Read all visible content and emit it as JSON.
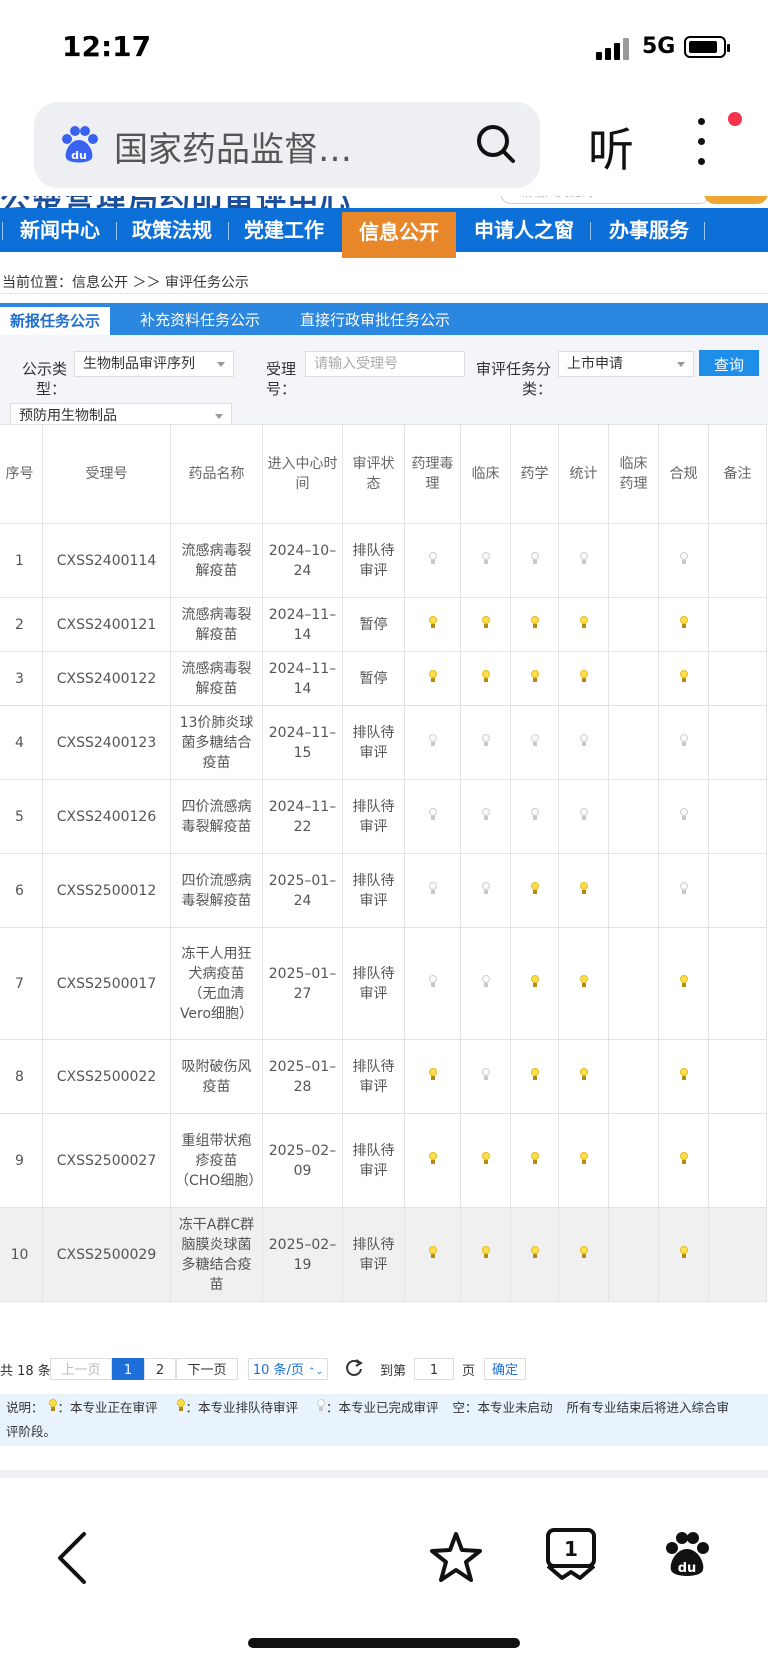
{
  "status_bar": {
    "time": "12:17",
    "network": "5G"
  },
  "browser": {
    "search_text": "国家药品监督…",
    "listen_label": "听"
  },
  "site": {
    "title_partial": "公楚営埋局约叩审评中心",
    "search_placeholder": "请输入关键词"
  },
  "nav": {
    "items": [
      {
        "label": "新闻中心"
      },
      {
        "label": "政策法规"
      },
      {
        "label": "党建工作"
      },
      {
        "label": "信息公开"
      },
      {
        "label": "申请人之窗"
      },
      {
        "label": "办事服务"
      }
    ],
    "active": "信息公开"
  },
  "breadcrumb": "当前位置：信息公开 ＞＞ 审评任务公示",
  "tabs": [
    {
      "label": "新报任务公示"
    },
    {
      "label": "补充资料任务公示"
    },
    {
      "label": "直接行政审批任务公示"
    }
  ],
  "filters": {
    "type_label_1": "公示类",
    "type_label_2": "型：",
    "type_value": "生物制品审评序列",
    "accept_label_1": "受理",
    "accept_label_2": "号：",
    "accept_placeholder": "请输入受理号",
    "task_label_1": "审评任务分",
    "task_label_2": "类：",
    "task_value": "上市申请",
    "sub_value": "预防用生物制品",
    "query_button": "查询"
  },
  "table": {
    "headers": [
      "序号",
      "受理号",
      "药品名称",
      "进入中心时间",
      "审评状态",
      "药理毒理",
      "临床",
      "药学",
      "统计",
      "临床药理",
      "合规",
      "备注"
    ],
    "rows": [
      {
        "no": "1",
        "code": "CXSS2400114",
        "name": "流感病毒裂解疫苗",
        "date": "2024–10–24",
        "status": "排队待审评",
        "flags": [
          0,
          0,
          0,
          0,
          null,
          0
        ]
      },
      {
        "no": "2",
        "code": "CXSS2400121",
        "name": "流感病毒裂解疫苗",
        "date": "2024–11–14",
        "status": "暂停",
        "flags": [
          1,
          1,
          1,
          1,
          null,
          1
        ]
      },
      {
        "no": "3",
        "code": "CXSS2400122",
        "name": "流感病毒裂解疫苗",
        "date": "2024–11–14",
        "status": "暂停",
        "flags": [
          1,
          1,
          1,
          1,
          null,
          1
        ]
      },
      {
        "no": "4",
        "code": "CXSS2400123",
        "name": "13价肺炎球菌多糖结合疫苗",
        "date": "2024–11–15",
        "status": "排队待审评",
        "flags": [
          0,
          0,
          0,
          0,
          null,
          0
        ]
      },
      {
        "no": "5",
        "code": "CXSS2400126",
        "name": "四价流感病毒裂解疫苗",
        "date": "2024–11–22",
        "status": "排队待审评",
        "flags": [
          0,
          0,
          0,
          0,
          null,
          0
        ]
      },
      {
        "no": "6",
        "code": "CXSS2500012",
        "name": "四价流感病毒裂解疫苗",
        "date": "2025–01–24",
        "status": "排队待审评",
        "flags": [
          0,
          0,
          1,
          1,
          null,
          0
        ]
      },
      {
        "no": "7",
        "code": "CXSS2500017",
        "name": "冻干人用狂犬病疫苗（无血清Vero细胞）",
        "date": "2025–01–27",
        "status": "排队待审评",
        "flags": [
          0,
          0,
          1,
          1,
          null,
          1
        ]
      },
      {
        "no": "8",
        "code": "CXSS2500022",
        "name": "吸附破伤风疫苗",
        "date": "2025–01–28",
        "status": "排队待审评",
        "flags": [
          1,
          0,
          1,
          1,
          null,
          1
        ]
      },
      {
        "no": "9",
        "code": "CXSS2500027",
        "name": "重组带状疱疹疫苗（CHO细胞）",
        "date": "2025–02–09",
        "status": "排队待审评",
        "flags": [
          1,
          1,
          1,
          1,
          null,
          1
        ]
      },
      {
        "no": "10",
        "code": "CXSS2500029",
        "name": "冻干A群C群脑膜炎球菌多糖结合疫苗",
        "date": "2025–02–19",
        "status": "排队待审评",
        "flags": [
          1,
          1,
          1,
          1,
          null,
          1
        ]
      }
    ]
  },
  "pager": {
    "total": "共 18 条",
    "prev": "上一页",
    "page1": "1",
    "page2": "2",
    "next": "下一页",
    "per_page": "10 条/页",
    "goto_label": "到第",
    "goto_value": "1",
    "page_unit": "页",
    "confirm": "确定"
  },
  "legend": {
    "intro": "说明：",
    "active": "：本专业正在审评",
    "queued": "：本专业排队待审评",
    "done": "：本专业已完成审评",
    "empty": "空：本专业未启动",
    "note_1": "所有专业结束后将进入综合审",
    "note_2": "评阶段。"
  },
  "colors": {
    "nav_blue": "#0d6fd8",
    "nav_active": "#e8872a",
    "tab_blue": "#2b87df",
    "query_blue": "#1e8ee8",
    "bulb_on": "#ffdf4d"
  },
  "icons": [
    "signal-icon",
    "battery-icon",
    "baidu-logo-icon",
    "search-icon",
    "more-icon",
    "back-icon",
    "star-icon",
    "tabs-icon",
    "baidu-home-icon",
    "refresh-icon"
  ]
}
